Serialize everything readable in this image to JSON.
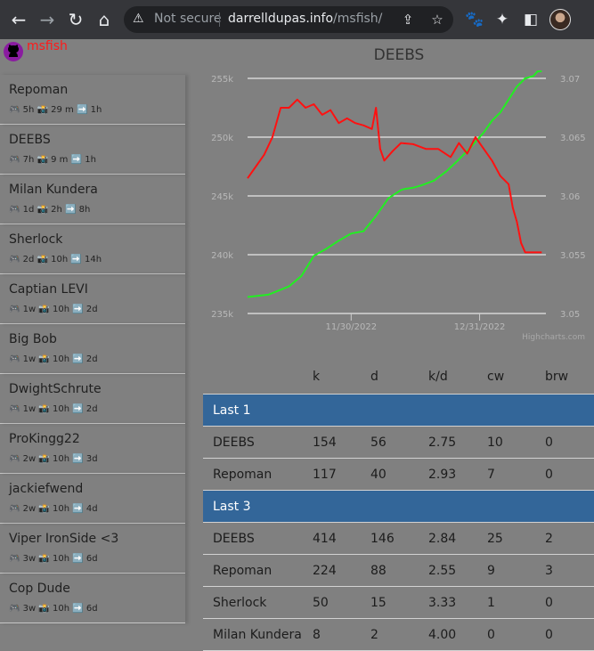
{
  "browser": {
    "security_label": "Not secure",
    "url_host": "darrelldupas.info",
    "url_path": "/msfish/"
  },
  "brand": "msfish",
  "sidebar": {
    "items": [
      {
        "name": "Repoman",
        "meta": "🎮 5h 📸 29 m ➡️ 1h"
      },
      {
        "name": "DEEBS",
        "meta": "🎮 7h 📸 9 m ➡️ 1h"
      },
      {
        "name": "Milan Kundera",
        "meta": "🎮 1d 📸 2h ➡️ 8h"
      },
      {
        "name": "Sherlock",
        "meta": "🎮 2d 📸 10h ➡️ 14h"
      },
      {
        "name": "Captian LEVI",
        "meta": "🎮 1w 📸 10h ➡️ 2d"
      },
      {
        "name": "Big Bob",
        "meta": "🎮 1w 📸 10h ➡️ 2d"
      },
      {
        "name": "DwightSchrute",
        "meta": "🎮 1w 📸 10h ➡️ 2d"
      },
      {
        "name": "ProKingg22",
        "meta": "🎮 2w 📸 10h ➡️ 3d"
      },
      {
        "name": "jackiefwend",
        "meta": "🎮 2w 📸 10h ➡️ 4d"
      },
      {
        "name": "Viper IronSide <3",
        "meta": "🎮 3w 📸 10h ➡️ 6d"
      },
      {
        "name": "Cop Dude",
        "meta": "🎮 3w 📸 10h ➡️ 6d"
      }
    ]
  },
  "chart_data": {
    "type": "line",
    "title": "DEEBS",
    "credits": "Highcharts.com",
    "x_ticks": [
      "11/30/2022",
      "12/31/2022"
    ],
    "y_left": {
      "ticks": [
        "235k",
        "240k",
        "245k",
        "250k",
        "255k"
      ],
      "range": [
        235000,
        255000
      ]
    },
    "y_right": {
      "ticks": [
        "3.05",
        "3.055",
        "3.06",
        "3.065",
        "3.07"
      ],
      "range": [
        3.05,
        3.07
      ]
    },
    "colors": {
      "green": "#22ee22",
      "red": "#ff1111",
      "grid": "#ffffff",
      "tick_text": "#b8b8b8"
    },
    "series": [
      {
        "axis": "left",
        "color": "#22ee22",
        "x": [
          "2022-11-05",
          "2022-11-10",
          "2022-11-15",
          "2022-11-18",
          "2022-11-21",
          "2022-11-24",
          "2022-11-27",
          "2022-11-30",
          "2022-12-03",
          "2022-12-06",
          "2022-12-09",
          "2022-12-12",
          "2022-12-13",
          "2022-12-15",
          "2022-12-17",
          "2022-12-20",
          "2022-12-23",
          "2022-12-26",
          "2022-12-29",
          "2023-01-01",
          "2023-01-03",
          "2023-01-05",
          "2023-01-07",
          "2023-01-09",
          "2023-01-11",
          "2023-01-13",
          "2023-01-14",
          "2023-01-15"
        ],
        "values": [
          236400,
          236600,
          237300,
          238200,
          239900,
          240500,
          241200,
          241800,
          242000,
          243300,
          244800,
          245500,
          245600,
          245700,
          245900,
          246300,
          247100,
          248100,
          249200,
          250400,
          251400,
          252100,
          253200,
          254300,
          255000,
          255200,
          255600,
          255600
        ]
      },
      {
        "axis": "right",
        "color": "#ff1111",
        "x": [
          "2022-11-05",
          "2022-11-07",
          "2022-11-09",
          "2022-11-11",
          "2022-11-13",
          "2022-11-15",
          "2022-11-17",
          "2022-11-19",
          "2022-11-21",
          "2022-11-23",
          "2022-11-25",
          "2022-11-27",
          "2022-11-29",
          "2022-12-01",
          "2022-12-03",
          "2022-12-05",
          "2022-12-06",
          "2022-12-07",
          "2022-12-08",
          "2022-12-10",
          "2022-12-12",
          "2022-12-15",
          "2022-12-18",
          "2022-12-21",
          "2022-12-24",
          "2022-12-26",
          "2022-12-28",
          "2022-12-30",
          "2023-01-01",
          "2023-01-03",
          "2023-01-05",
          "2023-01-07",
          "2023-01-08",
          "2023-01-09",
          "2023-01-10",
          "2023-01-11",
          "2023-01-13",
          "2023-01-15"
        ],
        "values": [
          3.0615,
          3.0625,
          3.0635,
          3.065,
          3.0675,
          3.0675,
          3.0682,
          3.0675,
          3.0678,
          3.0669,
          3.0673,
          3.0662,
          3.0666,
          3.0662,
          3.066,
          3.0657,
          3.0675,
          3.064,
          3.063,
          3.0638,
          3.0645,
          3.0644,
          3.064,
          3.064,
          3.0633,
          3.0645,
          3.0636,
          3.065,
          3.064,
          3.063,
          3.0617,
          3.061,
          3.059,
          3.0578,
          3.056,
          3.0552,
          3.0552,
          3.0552
        ]
      }
    ]
  },
  "table": {
    "headers": [
      "",
      "k",
      "d",
      "k/d",
      "cw",
      "brw"
    ],
    "groups": [
      {
        "label": "Last 1",
        "rows": [
          [
            "DEEBS",
            "154",
            "56",
            "2.75",
            "10",
            "0"
          ],
          [
            "Repoman",
            "117",
            "40",
            "2.93",
            "7",
            "0"
          ]
        ]
      },
      {
        "label": "Last 3",
        "rows": [
          [
            "DEEBS",
            "414",
            "146",
            "2.84",
            "25",
            "2"
          ],
          [
            "Repoman",
            "224",
            "88",
            "2.55",
            "9",
            "3"
          ],
          [
            "Sherlock",
            "50",
            "15",
            "3.33",
            "1",
            "0"
          ],
          [
            "Milan Kundera",
            "8",
            "2",
            "4.00",
            "0",
            "0"
          ]
        ]
      }
    ]
  }
}
